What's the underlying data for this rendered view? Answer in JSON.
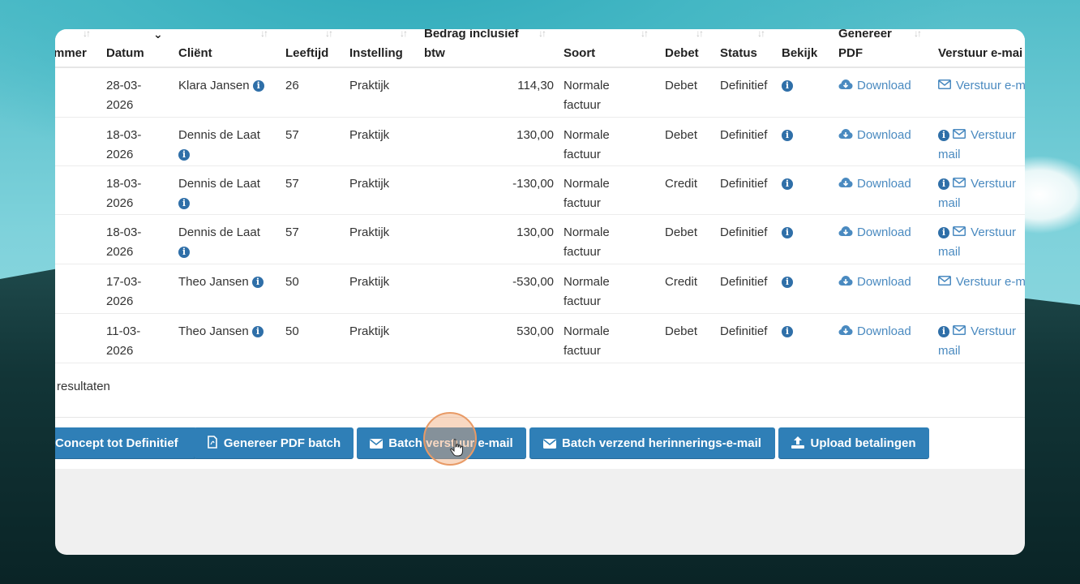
{
  "table": {
    "headers": {
      "nummer": "mmer",
      "datum": "Datum",
      "client": "Cliënt",
      "leeftijd": "Leeftijd",
      "instelling": "Instelling",
      "bedrag_line1": "Bedrag inclusief",
      "bedrag_line2": "btw",
      "soort": "Soort",
      "debet": "Debet",
      "status": "Status",
      "bekijk": "Bekijk",
      "genereer_line1": "Genereer",
      "genereer_line2": "PDF",
      "verstuur": "Verstuur e-mai"
    },
    "rows": [
      {
        "date1": "28-03-",
        "date2": "2026",
        "client": "Klara Jansen",
        "client_wrap": false,
        "age": "26",
        "inst": "Praktijk",
        "amount": "114,30",
        "soort1": "Normale",
        "soort2": "factuur",
        "debet": "Debet",
        "status": "Definitief",
        "download": "Download",
        "mail_info": false,
        "mail1": "Verstuur e-m",
        "mail2": ""
      },
      {
        "date1": "18-03-",
        "date2": "2026",
        "client": "Dennis de Laat",
        "client_wrap": true,
        "age": "57",
        "inst": "Praktijk",
        "amount": "130,00",
        "soort1": "Normale",
        "soort2": "factuur",
        "debet": "Debet",
        "status": "Definitief",
        "download": "Download",
        "mail_info": true,
        "mail1": "Verstuur",
        "mail2": "mail"
      },
      {
        "date1": "18-03-",
        "date2": "2026",
        "client": "Dennis de Laat",
        "client_wrap": true,
        "age": "57",
        "inst": "Praktijk",
        "amount": "-130,00",
        "soort1": "Normale",
        "soort2": "factuur",
        "debet": "Credit",
        "status": "Definitief",
        "download": "Download",
        "mail_info": true,
        "mail1": "Verstuur",
        "mail2": "mail"
      },
      {
        "date1": "18-03-",
        "date2": "2026",
        "client": "Dennis de Laat",
        "client_wrap": true,
        "age": "57",
        "inst": "Praktijk",
        "amount": "130,00",
        "soort1": "Normale",
        "soort2": "factuur",
        "debet": "Debet",
        "status": "Definitief",
        "download": "Download",
        "mail_info": true,
        "mail1": "Verstuur",
        "mail2": "mail"
      },
      {
        "date1": "17-03-",
        "date2": "2026",
        "client": "Theo Jansen",
        "client_wrap": false,
        "age": "50",
        "inst": "Praktijk",
        "amount": "-530,00",
        "soort1": "Normale",
        "soort2": "factuur",
        "debet": "Credit",
        "status": "Definitief",
        "download": "Download",
        "mail_info": false,
        "mail1": "Verstuur e-m",
        "mail2": ""
      },
      {
        "date1": "11-03-",
        "date2": "2026",
        "client": "Theo Jansen",
        "client_wrap": false,
        "age": "50",
        "inst": "Praktijk",
        "amount": "530,00",
        "soort1": "Normale",
        "soort2": "factuur",
        "debet": "Debet",
        "status": "Definitief",
        "download": "Download",
        "mail_info": true,
        "mail1": "Verstuur",
        "mail2": "mail"
      }
    ]
  },
  "results_text": "resultaten",
  "buttons": {
    "concept": "Concept tot Definitief",
    "pdf_batch": "Genereer PDF batch",
    "batch_email": "Batch verstuur e-mail",
    "reminder": "Batch verzend herinnerings-e-mail",
    "upload": "Upload betalingen"
  },
  "colors": {
    "button": "#2f7fb7",
    "link": "#4a8ac0",
    "info_icon": "#2f6fa8"
  }
}
